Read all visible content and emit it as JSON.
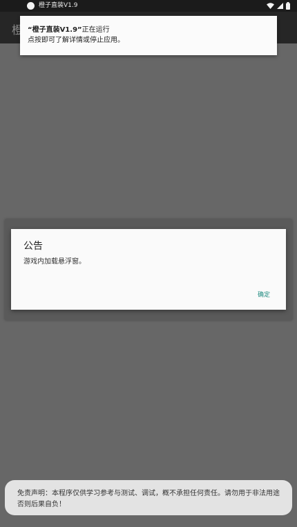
{
  "status_bar": {
    "title": "橙子直装V1.9",
    "icons": [
      "wifi-icon",
      "signal-icon",
      "battery-icon"
    ]
  },
  "app_bar": {
    "title": "橙"
  },
  "notification": {
    "app_name": "“橙子直装V1.9”",
    "running_text": "正在运行",
    "detail_text": "点按即可了解详情或停止应用。"
  },
  "dialog": {
    "title": "公告",
    "message": "游戏内加载悬浮窗。",
    "confirm_label": "确定"
  },
  "toast": {
    "text": "免责声明：本程序仅供学习参考与测试、调试，概不承担任何责任。请勿用于非法用途否则后果自负！"
  },
  "colors": {
    "accent": "#1e8a7f",
    "scrim": "#676767",
    "status_bar": "#1b1b1b",
    "app_bar": "#262626"
  }
}
